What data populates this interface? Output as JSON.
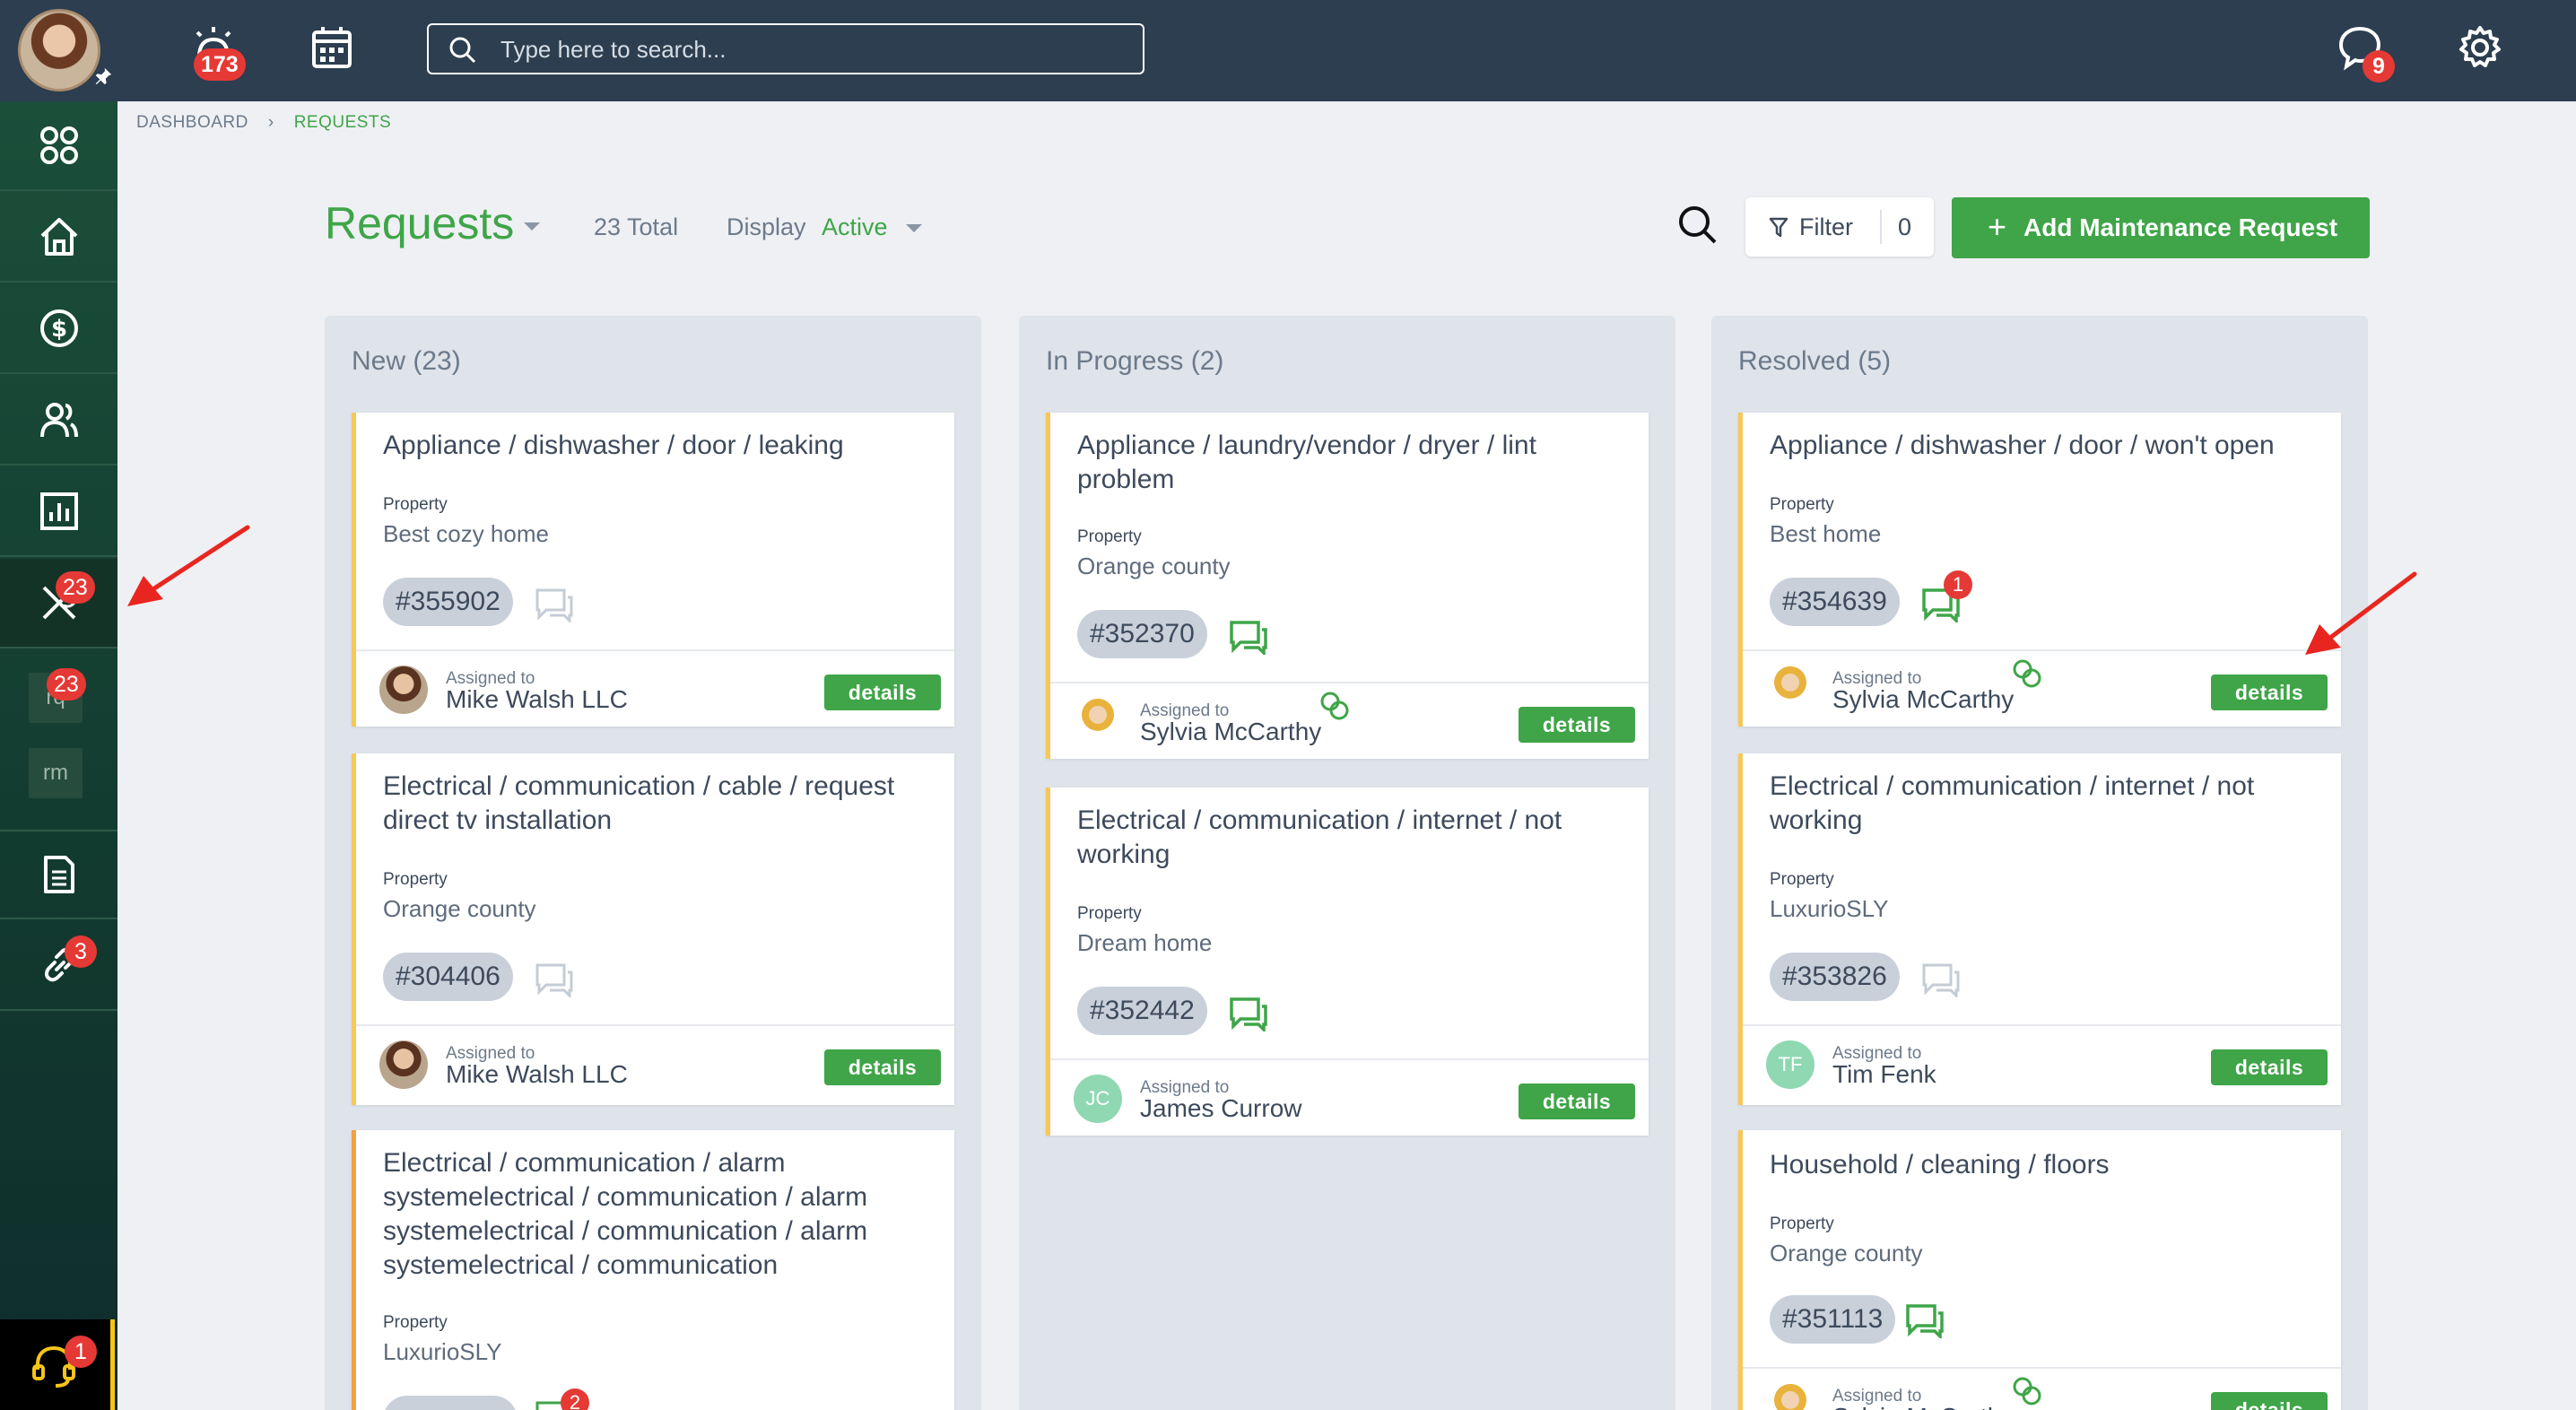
{
  "topbar": {
    "notifications_count": "173",
    "search_placeholder": "Type here to search...",
    "messages_count": "9"
  },
  "sidebar": {
    "maintenance_count": "23",
    "rq_count": "23",
    "rq_label": "rq",
    "rm_label": "rm",
    "links_count": "3",
    "help_count": "1"
  },
  "breadcrumb": {
    "dashboard": "DASHBOARD",
    "current": "REQUESTS"
  },
  "header": {
    "title": "Requests",
    "total": "23 Total",
    "display_label": "Display",
    "display_value": "Active",
    "filter_label": "Filter",
    "filter_count": "0",
    "add_label": "Add Maintenance Request"
  },
  "columns": [
    {
      "title": "New (23)",
      "cards": [
        {
          "title": "Appliance / dishwasher / door / leaking",
          "property_label": "Property",
          "property": "Best cozy home",
          "ticket": "#355902",
          "assigned_label": "Assigned to",
          "assignee": "Mike Walsh LLC",
          "details": "details"
        },
        {
          "title": "Electrical / communication / cable / request direct tv installation",
          "property_label": "Property",
          "property": "Orange county",
          "ticket": "#304406",
          "assigned_label": "Assigned to",
          "assignee": "Mike Walsh LLC",
          "details": "details"
        },
        {
          "title": "Electrical / communication / alarm systemelectrical / communication / alarm systemelectrical / communication / alarm systemelectrical / communication",
          "property_label": "Property",
          "property": "LuxurioSLY",
          "chat_count": "2"
        }
      ]
    },
    {
      "title": "In Progress (2)",
      "cards": [
        {
          "title": "Appliance / laundry/vendor / dryer / lint problem",
          "property_label": "Property",
          "property": "Orange county",
          "ticket": "#352370",
          "assigned_label": "Assigned to",
          "assignee": "Sylvia McCarthy",
          "details": "details"
        },
        {
          "title": "Electrical / communication / internet / not working",
          "property_label": "Property",
          "property": "Dream home",
          "ticket": "#352442",
          "assigned_label": "Assigned to",
          "assignee": "James Currow",
          "initials": "JC",
          "details": "details"
        }
      ]
    },
    {
      "title": "Resolved (5)",
      "cards": [
        {
          "title": "Appliance / dishwasher / door / won't open",
          "property_label": "Property",
          "property": "Best home",
          "ticket": "#354639",
          "chat_count": "1",
          "assigned_label": "Assigned to",
          "assignee": "Sylvia McCarthy",
          "details": "details"
        },
        {
          "title": "Electrical / communication / internet / not working",
          "property_label": "Property",
          "property": "LuxurioSLY",
          "ticket": "#353826",
          "assigned_label": "Assigned to",
          "assignee": "Tim Fenk",
          "initials": "TF",
          "details": "details"
        },
        {
          "title": "Household / cleaning / floors",
          "property_label": "Property",
          "property": "Orange county",
          "ticket": "#351113",
          "assigned_label": "Assigned to",
          "assignee": "Sylvia McCarthy",
          "details": "details"
        }
      ]
    }
  ],
  "colors": {
    "accent_green": "#3fa548",
    "topbar": "#2c3e50",
    "badge_red": "#e53935",
    "card_border_yellow": "#f6c85a",
    "card_border_orange": "#f0a441"
  }
}
